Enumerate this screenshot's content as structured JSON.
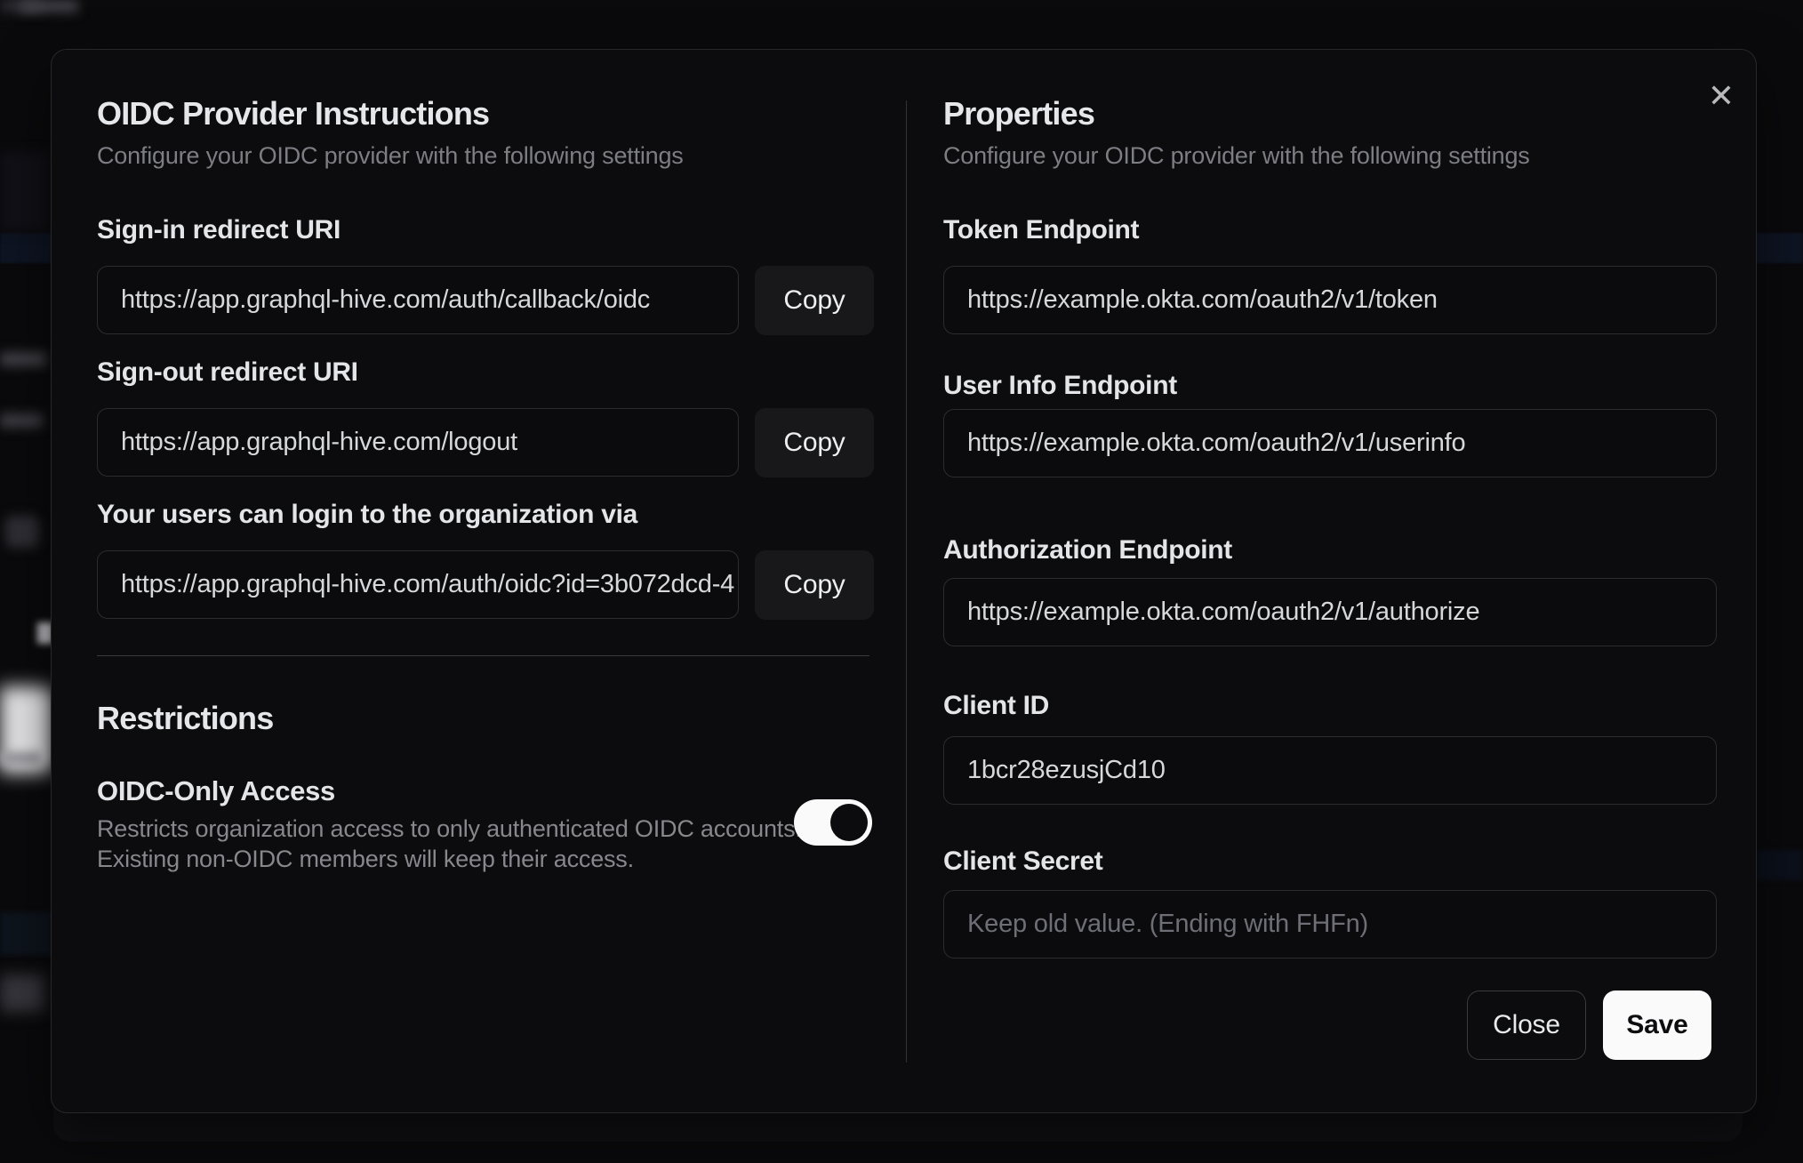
{
  "modal": {
    "close_icon": "✕",
    "left": {
      "title": "OIDC Provider Instructions",
      "subtitle": "Configure your OIDC provider with the following settings",
      "fields": [
        {
          "label": "Sign-in redirect URI",
          "value": "https://app.graphql-hive.com/auth/callback/oidc",
          "copy_label": "Copy"
        },
        {
          "label": "Sign-out redirect URI",
          "value": "https://app.graphql-hive.com/logout",
          "copy_label": "Copy"
        },
        {
          "label": "Your users can login to the organization via",
          "value": "https://app.graphql-hive.com/auth/oidc?id=3b072dcd-4",
          "copy_label": "Copy"
        }
      ],
      "restrictions": {
        "title": "Restrictions",
        "toggle": {
          "label": "OIDC-Only Access",
          "description_line1": "Restricts organization access to only authenticated OIDC accounts.",
          "description_line2": "Existing non-OIDC members will keep their access.",
          "enabled": true
        }
      }
    },
    "right": {
      "title": "Properties",
      "subtitle": "Configure your OIDC provider with the following settings",
      "fields": [
        {
          "label": "Token Endpoint",
          "value": "https://example.okta.com/oauth2/v1/token"
        },
        {
          "label": "User Info Endpoint",
          "value": "https://example.okta.com/oauth2/v1/userinfo"
        },
        {
          "label": "Authorization Endpoint",
          "value": "https://example.okta.com/oauth2/v1/authorize"
        },
        {
          "label": "Client ID",
          "value": "1bcr28ezusjCd10"
        },
        {
          "label": "Client Secret",
          "placeholder": "Keep old value. (Ending with FHFn)"
        }
      ],
      "footer": {
        "close_label": "Close",
        "save_label": "Save"
      }
    },
    "colors": {
      "modal_background": "#0c0c0e",
      "accent_button": "#fafafb",
      "toggle_on": "#fafafb"
    }
  }
}
